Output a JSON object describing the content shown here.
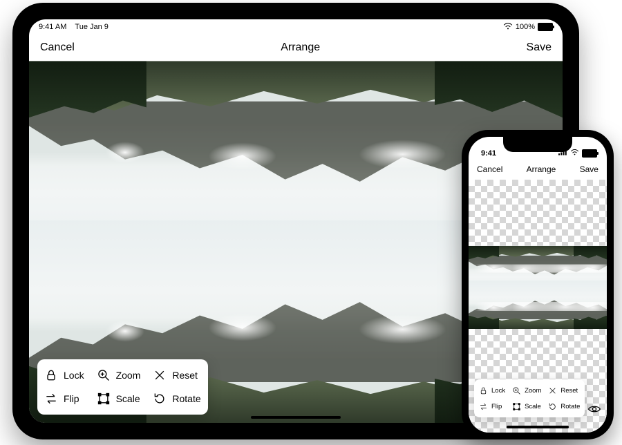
{
  "ipad": {
    "status": {
      "time": "9:41 AM",
      "date": "Tue Jan 9",
      "battery_pct": "100%"
    },
    "nav": {
      "cancel": "Cancel",
      "title": "Arrange",
      "save": "Save"
    }
  },
  "iphone": {
    "status": {
      "time": "9:41"
    },
    "nav": {
      "cancel": "Cancel",
      "title": "Arrange",
      "save": "Save"
    }
  },
  "tools": {
    "lock": "Lock",
    "zoom": "Zoom",
    "reset": "Reset",
    "flip": "Flip",
    "scale": "Scale",
    "rotate": "Rotate"
  },
  "icons": {
    "lock": "lock-icon",
    "zoom": "magnifier-plus-icon",
    "reset": "x-icon",
    "flip": "swap-horizontal-icon",
    "scale": "bounding-box-icon",
    "rotate": "rotate-icon",
    "eye": "eye-icon",
    "wifi": "wifi-icon",
    "signal": "cellular-signal-icon",
    "battery": "battery-icon"
  }
}
